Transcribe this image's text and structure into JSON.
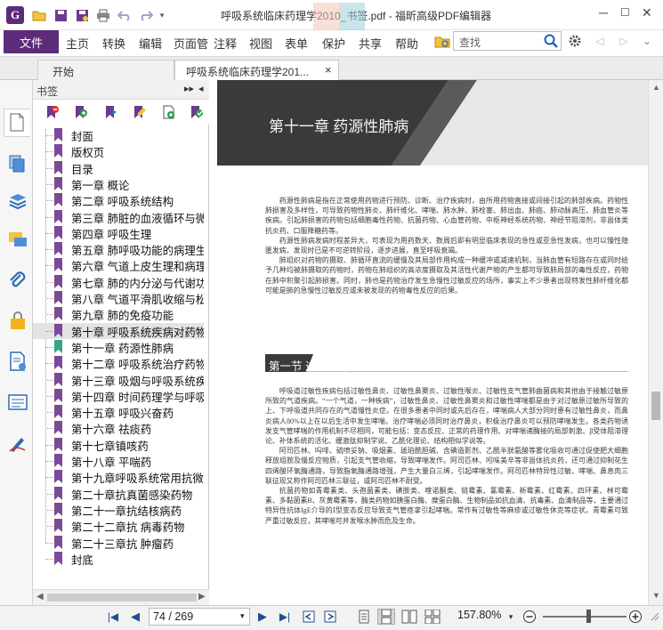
{
  "window": {
    "title": "呼吸系统临床药理学2010_书签.pdf - 福昕高级PDF编辑器",
    "logo_glyph": "G"
  },
  "menu": {
    "file": "文件",
    "items": [
      "主页",
      "转换",
      "编辑",
      "页面管",
      "注释",
      "视图",
      "表单",
      "保护",
      "共享",
      "帮助"
    ]
  },
  "search": {
    "placeholder": "查找"
  },
  "tabs": [
    {
      "label": "开始"
    },
    {
      "label": "呼吸系统临床药理学201...",
      "close": "×"
    }
  ],
  "bookmarks": {
    "header": "书签",
    "items": [
      "封面",
      "版权页",
      "目录",
      "第一章 概论",
      "第二章 呼吸系统结构",
      "第三章 肺脏的血液循环与微循",
      "第四章 呼吸生理",
      "第五章 肺呼吸功能的病理生理",
      "第六章 气道上皮生理和病理",
      "第七章 肺的内分泌与代谢功能",
      "第八章 气道平滑肌收缩与松弛",
      "第九章 肺的免疫功能",
      "第十章 呼吸系统疾病对药物吸",
      "第十一章 药源性肺病",
      "第十二章 呼吸系统治疗药物相",
      "第十三章 吸烟与呼吸系统疾病",
      "第十四章 时间药理学与呼吸系",
      "第十五章 呼吸兴奋药",
      "第十六章 祛痰药",
      "第十七章镇咳药",
      "第十八章 平喘药",
      "第十九章呼吸系统常用抗微生",
      "第二十章抗真菌感染药物",
      "第二十一章抗结核病药",
      "第二十二章抗 病毒药物",
      "第二十三章抗 肿瘤药",
      "封底"
    ],
    "selected_index": 12
  },
  "document": {
    "chapter_title": "第十一章  药源性肺病",
    "section_title": "第一节  过敏性哮喘",
    "paragraphs_intro": [
      "药源性肺病是指在正常使用药物进行预防、诊断、治疗疾病时，由所用药物直接或间接引起的肺部疾病。药物性肺损害及多样性，可导致药物性肺炎、肺纤维化、哮喘、肺水肿、肺栓塞、肺出血、肺癌、肺动脉高压、肺血管炎等疾病。引起肺损害的药物包括细胞毒性药物、抗菌药物、心血管药物、中枢神经系统药物、神经节阻滞剂，非甾体类抗炎药、口服降糖药等。",
      "药源性肺病发病时程差异大，可表现为用药数天、数周后即有明显临床表现的急性或亚急性发病，也可以慢性隐匿发病，发现时已是不可逆转阶段，逐步进展，直至呼吸衰竭。",
      "肺组织对药物的摄取、肺循环直流的缓慢及其局部作用构成一种缓冲或减速机制，当肺血管有短路存在或同时给予几种均被肺摄取的药物时，药物在肺组织的高浓度摄取及其活性代谢产物的产生都可导致肺局部的毒性反应，药物在肺中积聚引起肺损害。同时，肺也是药物治疗发生急慢性过敏反应的场所，事实上不少患者出现特发性肺纤维化都可能是肺的急慢性过敏反应或未被发现的药物毒性反应的后果。"
    ],
    "paragraphs_section": [
      "呼吸道过敏性疾病包括过敏性鼻炎、过敏性鼻窦炎、过敏性喉炎、过敏性支气管肺曲菌病和其他由于接触过敏原所致的气道疾病。“一个气道，一种疾病”，过敏性鼻炎、过敏性鼻窦炎和过敏性哮喘都是由于对过敏原过敏所导致的上、下呼吸道共同存在的气道慢性炎症。在很多患者中同时或先后存在，哮喘病人大部分同时患有过敏性鼻炎，而鼻炎病人80%以上在以后生活中发生哮喘。治疗哮喘必须同时治疗鼻炎，积极治疗鼻炎可以预防哮喘发生。各类药物诱发支气管哮喘的作用机制不尽相同，可能包括：变态反应、正常的药理作用、对哮喘诸酶接的局部刺激、β受体阻滞理论、补体系统的活化、缓激肽抑制学说、乙酰化理论、结构相似学说等。",
      "阿司匹林、吗啡、硫喷妥钠、吸烟素、琥珀酰胆碱、含碘造影剂、乙酰半胱氨酸等雾化吸收可通过促使肥大细胞释放组胺及慢反应物质，引起支气管收缩，导致哮喘发作。阿司匹林、吲哚美辛等非甾体抗炎药，还可通过抑制花生四烯酸环氧酶通路，导致脂氧酶通路增强，产生大量白三烯，引起哮喘发作。阿司匹林特异性过敏、哮喘、鼻息肉三联征现又称作阿司匹林三联征，或阿司匹林不耐受。",
      "抗菌药物如青霉素类、头孢菌素类、磺胺类、喹诺酮类、链霉素、氯霉素、新霉素、红霉素、四环素、林可霉素、多黏菌素B、灰黄霉素等，酶类药物如胰蛋白酶、糜蛋白酶、生物制品如抗血清、抗毒素、血清制品等，主要通过特异性抗体IgE介导的Ⅰ型变态反应导致支气管痉挛引起哮喘。常作有过敏性等麻疹或过敏性休克等症状。青霉素可致严重过敏反应，其哮喘可并发喉水肿而危及生命。"
    ]
  },
  "footer": {
    "page_display": "74 / 269",
    "zoom": "157.80%"
  },
  "colors": {
    "brand": "#5c2c7a",
    "bookmark_flag": "#7b4a96",
    "bookmark_flag_current": "#3aa38a",
    "chapter_band": "#3a3a3a"
  }
}
